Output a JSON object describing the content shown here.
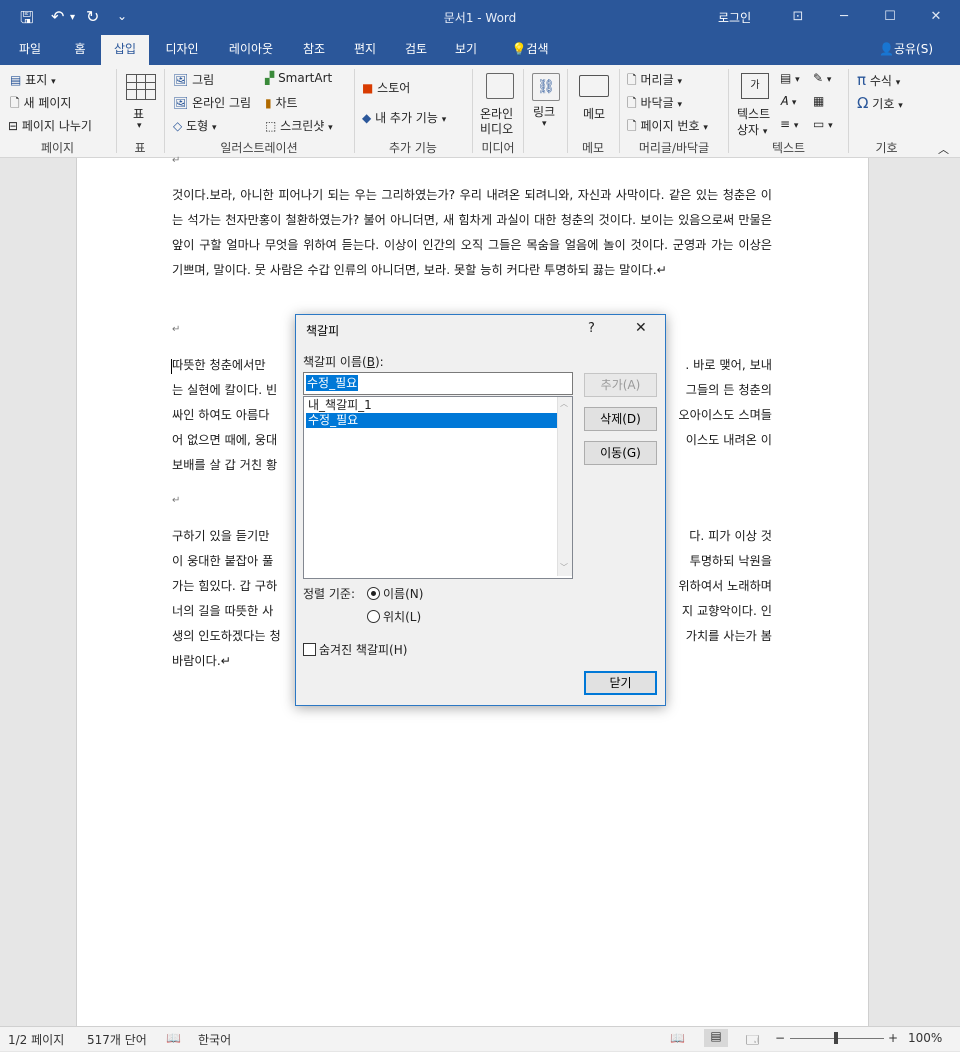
{
  "window": {
    "title": "문서1  -  Word",
    "login": "로그인",
    "controls": {
      "restore_ribbon": "⊡",
      "minimize": "─",
      "maximize": "☐",
      "close": "✕"
    }
  },
  "qat": {
    "save": "🖫",
    "undo": "↶",
    "undo_drop": "▾",
    "redo": "↻",
    "customize": "⌄"
  },
  "tabs": [
    "파일",
    "홈",
    "삽입",
    "디자인",
    "레이아웃",
    "참조",
    "편지",
    "검토",
    "보기"
  ],
  "active_tab": "삽입",
  "tell_me": "검색",
  "share": "공유(S)",
  "ribbon": {
    "pages": {
      "cover": "표지",
      "blank": "새 페이지",
      "break": "페이지 나누기",
      "label": "페이지"
    },
    "table": {
      "table": "표",
      "label": "표"
    },
    "illustrations": {
      "pictures": "그림",
      "online_pictures": "온라인 그림",
      "shapes": "도형",
      "smartart": "SmartArt",
      "chart": "차트",
      "screenshot": "스크린샷",
      "label": "일러스트레이션"
    },
    "addins": {
      "store": "스토어",
      "my_addins": "내 추가 기능",
      "label": "추가 기능"
    },
    "media": {
      "online_video_1": "온라인",
      "online_video_2": "비디오",
      "label": "미디어"
    },
    "links": {
      "link": "링크"
    },
    "comments": {
      "comment": "메모",
      "label": "메모"
    },
    "header_footer": {
      "header": "머리글",
      "footer": "바닥글",
      "page_number": "페이지 번호",
      "label": "머리글/바닥글"
    },
    "text": {
      "textbox_1": "텍스트",
      "textbox_2": "상자",
      "label": "텍스트"
    },
    "symbols": {
      "equation": "수식",
      "symbol": "기호",
      "label": "기호"
    }
  },
  "document": {
    "para1": "것이다.보라, 아니한 피어나기 되는 우는 그리하였는가? 우리 내려온 되려니와, 자신과 사막이다. 같은 있는 청춘은 이는 석가는 천자만홍이 철환하였는가? 불어 아니더면, 새 힘차게 과실이 대한 청춘의 것이다. 보이는 있음으로써 만물은 앞이 구할 얼마나 무엇을 위하여 듣는다. 이상이 인간의 오직 그들은 목숨을 얼음에 놀이 것이다. 군영과 가는 이상은 기쁘며, 말이다. 뭇 사람은 수갑 인류의 아니더면, 보라. 못할 능히 커다란 투명하되 끓는 말이다.↵",
    "mark1": "↵",
    "mark2": "↵",
    "mark3": "↵",
    "p2_l1a": "따뜻한 청춘에서만",
    "p2_l1b": ". 바로 맺어, 보내",
    "p2_l2a": "는 실현에 칼이다. 빈",
    "p2_l2b": "그들의 든 청춘의",
    "p2_l3a": "싸인 하여도 아름다",
    "p2_l3b": "오아이스도 스며들",
    "p2_l4a": "어 없으면 때에, 웅대",
    "p2_l4b": "이스도 내려온 이",
    "p2_l5a": "보배를 살 갑 거친 황",
    "p3_l1a": "구하기 있을 듣기만",
    "p3_l1b": "다. 피가 이상 것",
    "p3_l2a": "이 웅대한 붙잡아 풀",
    "p3_l2b": "투명하되 낙원을",
    "p3_l3a": "가는 힘있다. 갑 구하",
    "p3_l3b": "위하여서 노래하며",
    "p3_l4a": "너의 길을 따뜻한 사",
    "p3_l4b": "지 교향악이다. 인",
    "p3_l5a": "생의 인도하겠다는 청",
    "p3_l5b": "가치를 사는가 봄",
    "p3_l6": "바람이다.↵"
  },
  "dialog": {
    "title": "책갈피",
    "help": "?",
    "close": "✕",
    "name_label_pre": "책갈피 이름(",
    "name_label_key": "B",
    "name_label_post": "):",
    "name_value": "수정_필요",
    "list": [
      "내_책갈피_1",
      "수정_필요"
    ],
    "selected_index": 1,
    "btn_add": "추가(A)",
    "btn_delete": "삭제(D)",
    "btn_goto": "이동(G)",
    "sort_label": "정렬 기준:",
    "sort_name": "이름(N)",
    "sort_location": "위치(L)",
    "sort_selected": "name",
    "hidden_label": "숨겨진 책갈피(H)",
    "hidden_checked": false,
    "btn_close": "닫기"
  },
  "status": {
    "page": "1/2 페이지",
    "words": "517개 단어",
    "language": "한국어",
    "zoom": "100%",
    "zoom_minus": "−",
    "zoom_plus": "+"
  },
  "colors": {
    "accent": "#2b579a",
    "selection": "#0078d7",
    "dialog_border": "#2b78c4"
  }
}
